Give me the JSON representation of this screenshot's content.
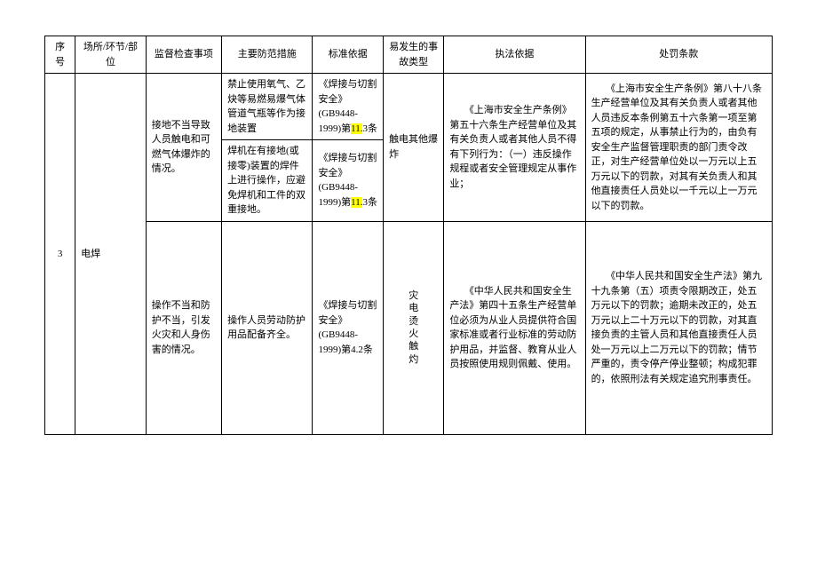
{
  "headers": {
    "col1": "序号",
    "col2": "场所/环节/部位",
    "col3": "监督检查事项",
    "col4": "主要防范措施",
    "col5": "标准依据",
    "col6": "易发生的事故类型",
    "col7": "执法依据",
    "col8": "处罚条款"
  },
  "row_num": "3",
  "place": "电焊",
  "r1": {
    "inspect": "接地不当导致人员触电和可燃气体爆炸的情况。",
    "measure": "禁止使用氧气、乙炔等易燃易爆气体管道气瓶等作为接地装置",
    "standard_prefix1": "《焊接与切割安全》(GB9448-1999)第",
    "standard_hl": "11.",
    "standard_suffix": "3条",
    "accident": "触电其他爆炸",
    "law": "《上海市安全生产条例》第五十六条生产经营单位及其有关负责人或者其他人员不得有下列行为：（一）违反操作规程或者安全管理规定从事作业；",
    "penalty": "《上海市安全生产条例》第八十八条生产经营单位及其有关负责人或者其他人员违反本条例第五十六条第一项至第五项的规定，从事禁止行为的，由负有安全生产监督管理职责的部门责令改正，对生产经营单位处以一万元以上五万元以下的罚款，对其有关负责人和其他直接责任人员处以一千元以上一万元以下的罚款。"
  },
  "r2": {
    "measure": "焊机在有接地(或接零)装置的焊件上进行操作，应避免焊机和工件的双重接地。",
    "standard_prefix1": "《焊接与切割安全》(GB9448-1999)第",
    "standard_hl": "11.",
    "standard_suffix": "3条"
  },
  "r3": {
    "inspect": "操作不当和防护不当，引发火灾和人身伤害的情况。",
    "measure": "操作人员劳动防护用品配备齐全。",
    "standard": "《焊接与切割安全》(GB9448-1999)第4.2条",
    "accident": "灾电烫火触灼",
    "law": "《中华人民共和国安全生产法》第四十五条生产经营单位必须为从业人员提供符合国家标准或者行业标准的劳动防护用品，并监督、教育从业人员按照使用规则佩戴、使用。",
    "penalty": "《中华人民共和国安全生产法》第九十九条第（五）项责令限期改正，处五万元以下的罚款；逾期未改正的，处五万元以上二十万元以下的罚款，对其直接负责的主管人员和其他直接责任人员处一万元以上二万元以下的罚款；情节严重的，责令停产停业整顿；构成犯罪的，依照刑法有关规定追究刑事责任。"
  }
}
